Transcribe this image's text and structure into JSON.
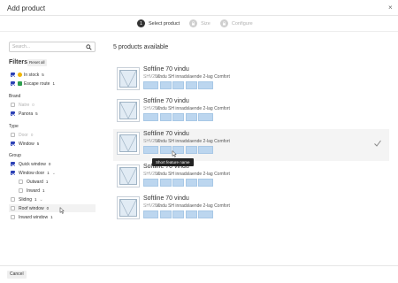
{
  "header": {
    "title": "Add product",
    "close_glyph": "×"
  },
  "stepper": {
    "steps": [
      {
        "number": "1",
        "label": "Select product",
        "state": "active"
      },
      {
        "label": "Size",
        "state": "inactive",
        "icon": "lock-icon"
      },
      {
        "label": "Configure",
        "state": "inactive",
        "icon": "lock-icon"
      }
    ]
  },
  "sidebar": {
    "search_placeholder": "Search...",
    "filters_title": "Filters",
    "reset_label": "Reset all",
    "availability": [
      {
        "label": "In stock",
        "count": "5",
        "checked": true,
        "icon": "stock-dot-icon",
        "icon_color": "#f0b400"
      },
      {
        "label": "Escape route",
        "count": "1",
        "checked": true,
        "icon": "escape-route-icon",
        "icon_color": "#2e9e4f"
      }
    ],
    "brand": {
      "heading": "Brand",
      "items": [
        {
          "label": "Natre",
          "count": "0",
          "checked": false,
          "muted": true
        },
        {
          "label": "Panora",
          "count": "5",
          "checked": true,
          "muted": false
        }
      ]
    },
    "type": {
      "heading": "Type",
      "items": [
        {
          "label": "Door",
          "count": "0",
          "checked": false,
          "muted": true
        },
        {
          "label": "Window",
          "count": "5",
          "checked": true,
          "muted": false
        }
      ]
    },
    "group": {
      "heading": "Group",
      "items": [
        {
          "label": "Quick window",
          "count": "0",
          "checked": true
        },
        {
          "label": "Window door",
          "count": "1",
          "checked": true,
          "chevron": "⌄"
        },
        {
          "label": "Outward",
          "count": "1",
          "checked": false
        },
        {
          "label": "Inward",
          "count": "1",
          "checked": false
        },
        {
          "label": "Sliding",
          "count": "1",
          "checked": false,
          "chevron": "⌄"
        },
        {
          "label": "Roof window",
          "count": "0",
          "checked": false
        },
        {
          "label": "Inward window",
          "count": "1",
          "checked": false
        }
      ]
    }
  },
  "main": {
    "count_label": "5 products available",
    "products": [
      {
        "name": "Softline 70 vindu",
        "code": "SHV2LC",
        "desc": "Vindu SH innadslaende 2-lag Comfort"
      },
      {
        "name": "Softline 70 vindu",
        "code": "SHV2LC",
        "desc": "Vindu SH innadslaende 2-lag Comfort"
      },
      {
        "name": "Softline 70 vindu",
        "code": "SHV2LC",
        "desc": "Vindu SH innadslaende 2-lag Comfort"
      },
      {
        "name": "Softline 70 vindu",
        "code": "SHV2LC",
        "desc": "Vindu SH innadslaende 2-lag Comfort"
      },
      {
        "name": "Softline 70 vindu",
        "code": "SHV2LC",
        "desc": "Vindu SH innadslaende 2-lag Comfort"
      }
    ],
    "tooltip": "Short feature name"
  },
  "footer": {
    "cancel_label": "Cancel"
  },
  "colors": {
    "accent": "#2a3fb5",
    "feature_tile": "#bcd6ef",
    "selected_row": "#f4f4f4"
  }
}
